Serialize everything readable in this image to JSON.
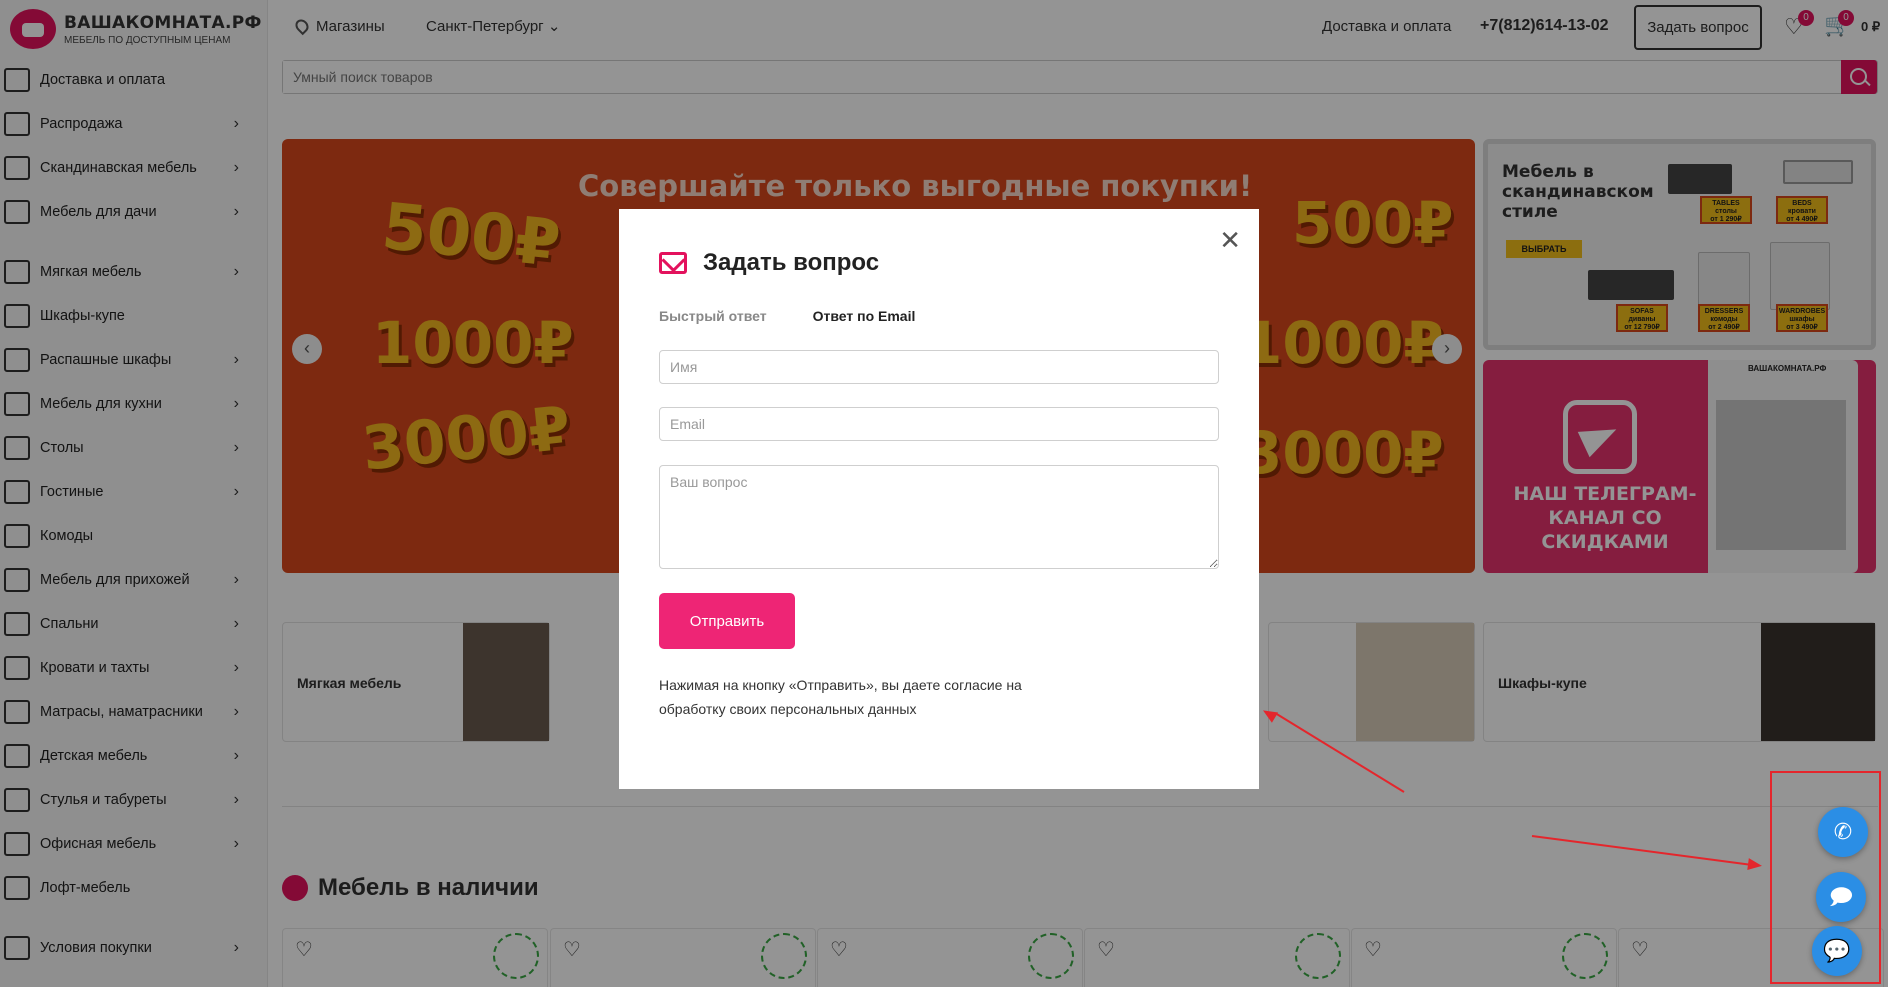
{
  "logo": {
    "title": "ВАШАКОМНАТА.РФ",
    "subtitle": "МЕБЕЛЬ ПО ДОСТУПНЫМ ЦЕНАМ"
  },
  "sidebar": {
    "items": [
      {
        "label": "Доставка и оплата",
        "icon": "truck-icon",
        "arrow": false
      },
      {
        "label": "Распродажа",
        "icon": "sale-tag-icon",
        "arrow": true
      },
      {
        "label": "Скандинавская мебель",
        "icon": "sofa-color-icon",
        "arrow": true
      },
      {
        "label": "Мебель для дачи",
        "icon": "chair-icon",
        "arrow": true
      },
      {
        "label": "Мягкая мебель",
        "icon": "sofa-icon",
        "arrow": true
      },
      {
        "label": "Шкафы-купе",
        "icon": "wardrobe-icon",
        "arrow": false
      },
      {
        "label": "Распашные шкафы",
        "icon": "cabinet-icon",
        "arrow": true
      },
      {
        "label": "Мебель для кухни",
        "icon": "kitchen-icon",
        "arrow": true
      },
      {
        "label": "Столы",
        "icon": "table-icon",
        "arrow": true
      },
      {
        "label": "Гостиные",
        "icon": "living-room-icon",
        "arrow": true
      },
      {
        "label": "Комоды",
        "icon": "dresser-icon",
        "arrow": false
      },
      {
        "label": "Мебель для прихожей",
        "icon": "hallway-icon",
        "arrow": true
      },
      {
        "label": "Спальни",
        "icon": "bedroom-icon",
        "arrow": true
      },
      {
        "label": "Кровати и тахты",
        "icon": "bed-icon",
        "arrow": true
      },
      {
        "label": "Матрасы, наматрасники",
        "icon": "mattress-icon",
        "arrow": true
      },
      {
        "label": "Детская мебель",
        "icon": "kids-icon",
        "arrow": true
      },
      {
        "label": "Стулья и табуреты",
        "icon": "stool-icon",
        "arrow": true
      },
      {
        "label": "Офисная мебель",
        "icon": "office-chair-icon",
        "arrow": true
      },
      {
        "label": "Лофт-мебель",
        "icon": "loft-icon",
        "arrow": false
      },
      {
        "label": "Условия покупки",
        "icon": "terms-icon",
        "arrow": true
      }
    ]
  },
  "header": {
    "stores": "Магазины",
    "city": "Санкт-Петербург",
    "delivery": "Доставка и оплата",
    "phone": "+7(812)614-13-02",
    "ask_button": "Задать вопрос",
    "favorites_count": "0",
    "cart_count": "0",
    "cart_sum": "0 ₽"
  },
  "search": {
    "placeholder": "Умный поиск товаров"
  },
  "banner": {
    "headline": "Совершайте только выгодные покупки!",
    "prices": [
      "500₽",
      "1000₽",
      "3000₽"
    ]
  },
  "side_banner_1": {
    "title": "Мебель в скандинавском стиле",
    "button": "ВЫБРАТЬ",
    "tags": [
      {
        "name": "TABLES",
        "sub": "столы",
        "price": "от 1 290₽"
      },
      {
        "name": "BEDS",
        "sub": "кровати",
        "price": "от 4 490₽"
      },
      {
        "name": "SOFAS",
        "sub": "диваны",
        "price": "от 12 790₽"
      },
      {
        "name": "DRESSERS",
        "sub": "комоды",
        "price": "от 2 490₽"
      },
      {
        "name": "WARDROBES",
        "sub": "шкафы",
        "price": "от 3 490₽"
      }
    ]
  },
  "side_banner_2": {
    "text": "НАШ ТЕЛЕГРАМ-КАНАЛ СО СКИДКАМИ",
    "channel": "ВАШАКОМНАТА.РФ"
  },
  "categories": [
    {
      "label": "Мягкая мебель"
    },
    {
      "label": ""
    },
    {
      "label": ""
    },
    {
      "label": ""
    },
    {
      "label": "Шкафы-купе"
    }
  ],
  "section": {
    "title": "Мебель в наличии"
  },
  "modal": {
    "title": "Задать вопрос",
    "tab_quick": "Быстрый ответ",
    "tab_email": "Ответ по Email",
    "name_placeholder": "Имя",
    "email_placeholder": "Email",
    "question_placeholder": "Ваш вопрос",
    "submit": "Отправить",
    "consent": "Нажимая на кнопку «Отправить», вы даете согласие на обработку своих персональных данных"
  },
  "colors": {
    "accent": "#e3125d",
    "button": "#ee2575",
    "chat": "#2b8ee5",
    "annotation": "#e4262c"
  }
}
